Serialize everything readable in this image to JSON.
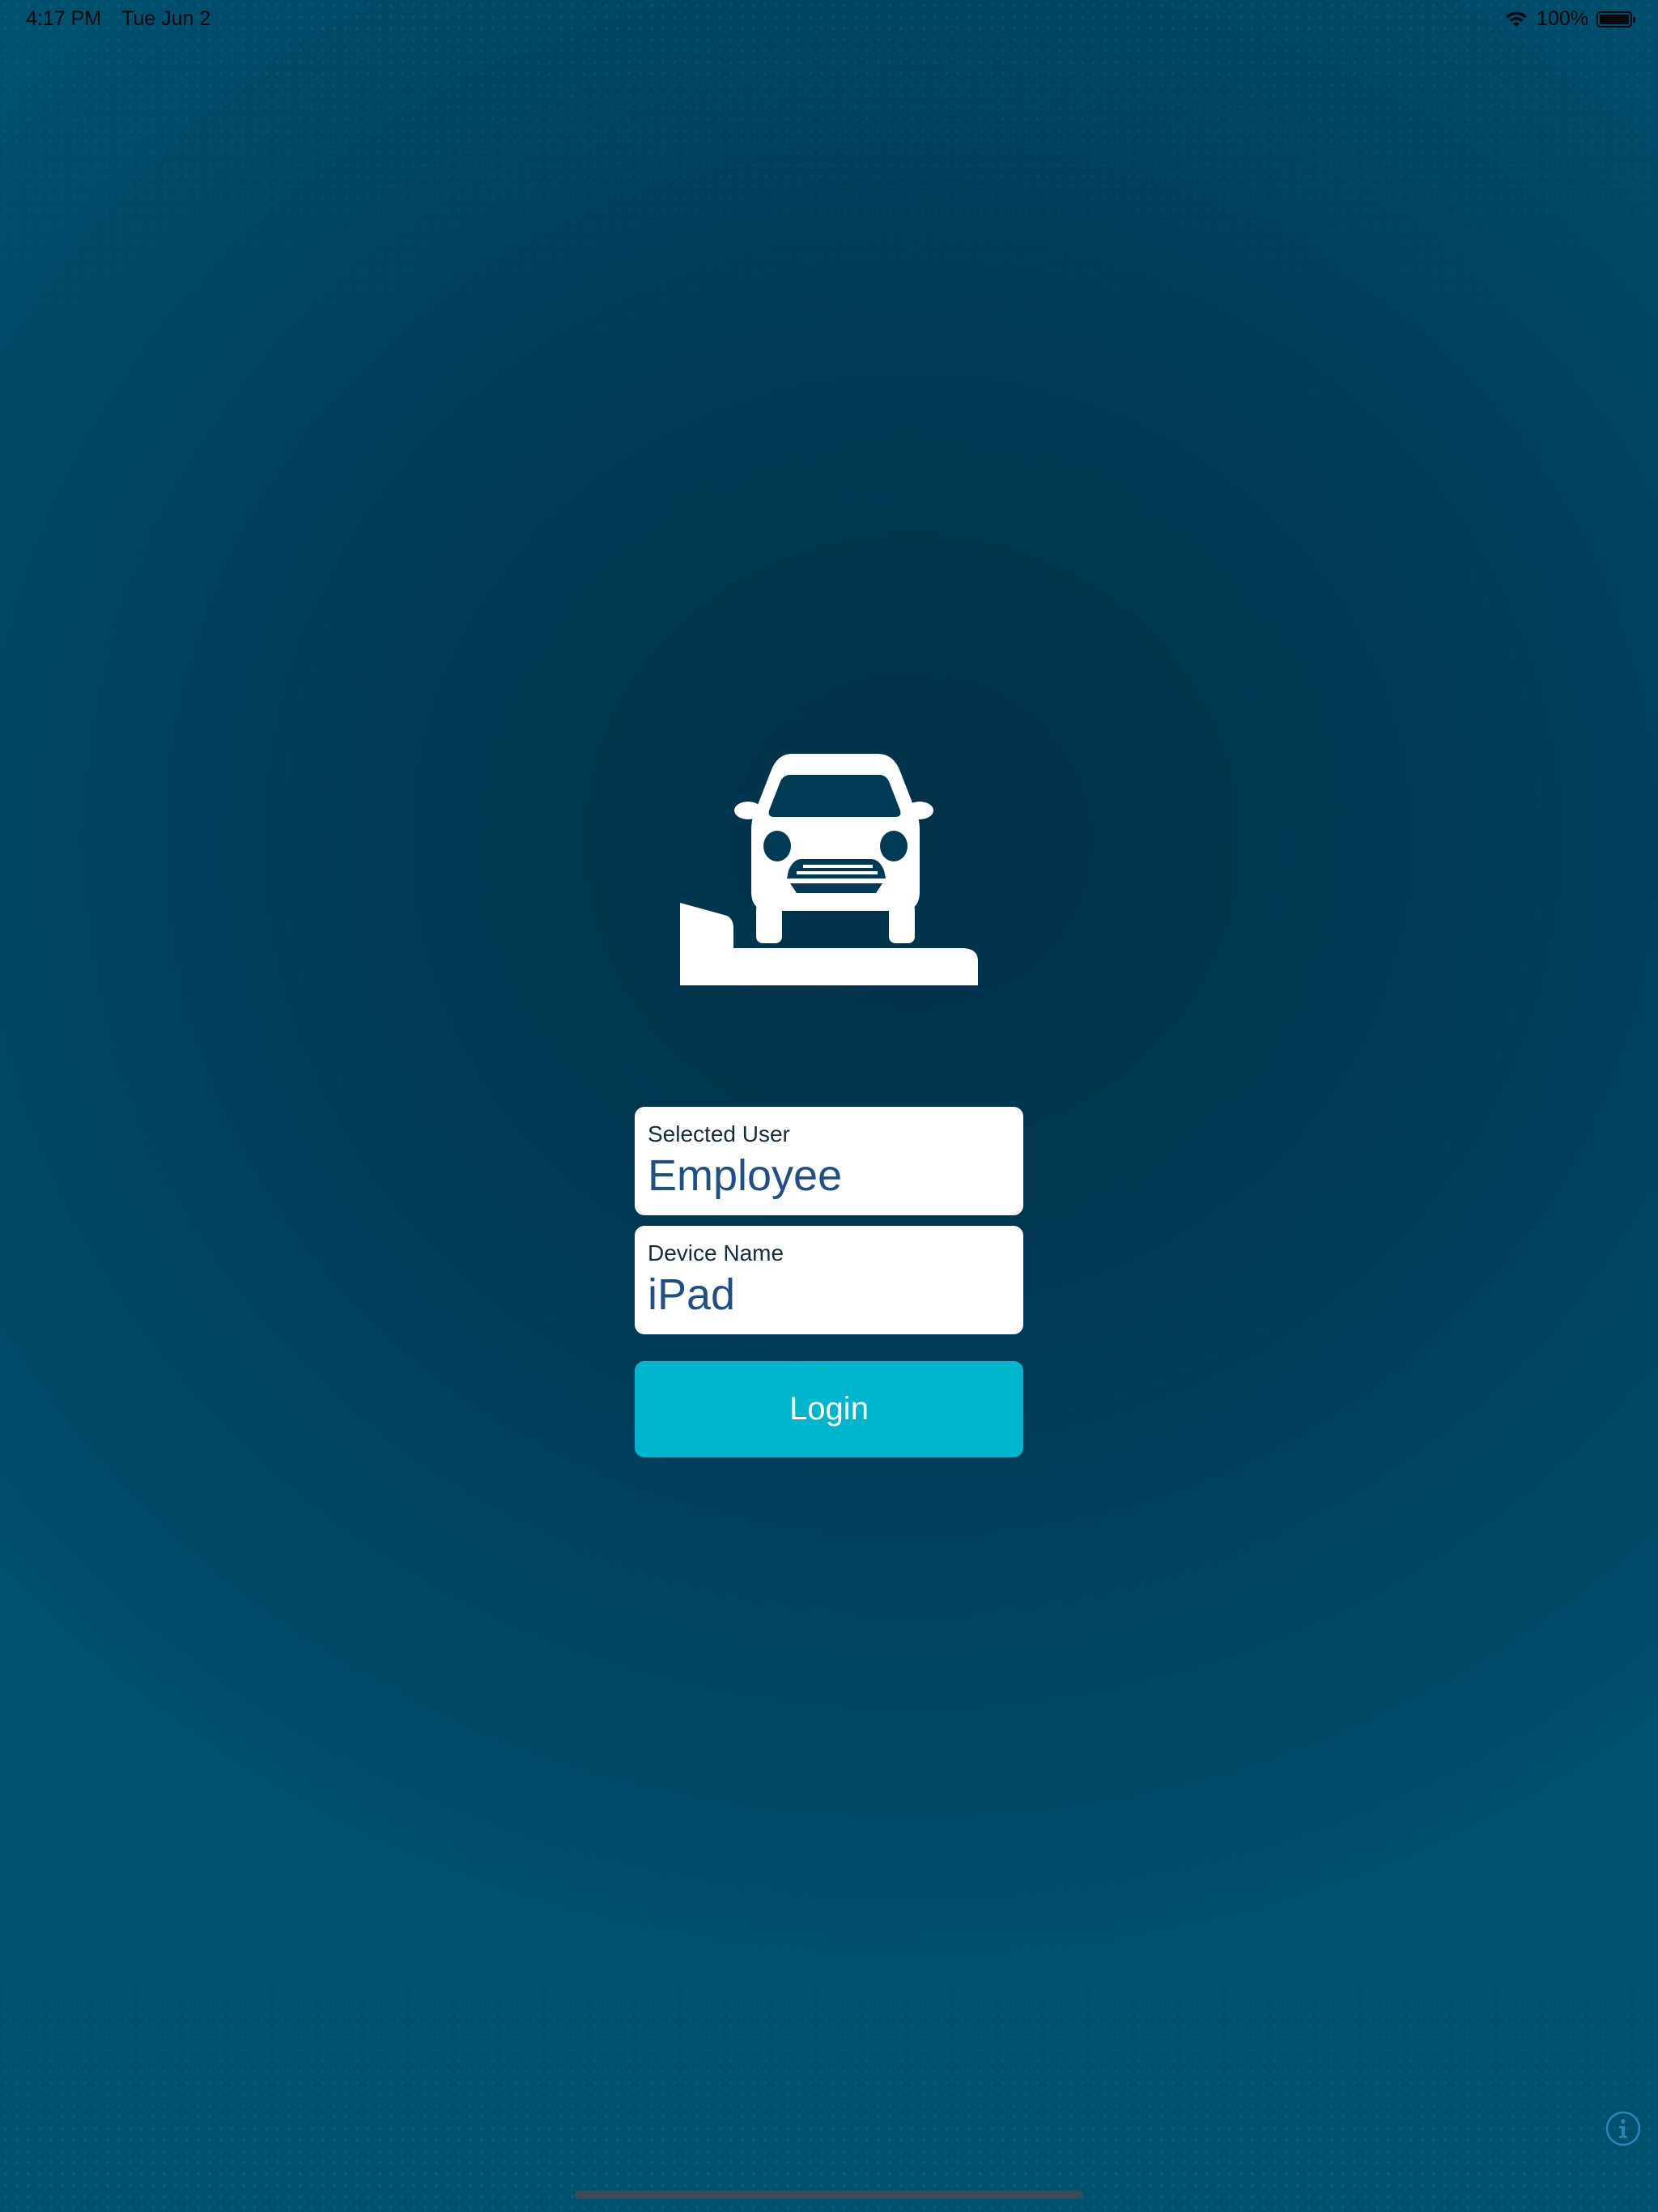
{
  "status_bar": {
    "time": "4:17 PM",
    "date": "Tue Jun 2",
    "battery_percent": "100%",
    "icons": [
      "wifi-icon",
      "battery-icon"
    ]
  },
  "logo": {
    "icon": "car-on-ramp-icon"
  },
  "form": {
    "user_label": "Selected User",
    "user_value": "Employee",
    "device_label": "Device Name",
    "device_value": "iPad",
    "login_label": "Login"
  },
  "footer": {
    "info_icon": "info-icon"
  },
  "colors": {
    "background": "#003a55",
    "field_bg": "#ffffff",
    "field_value": "#1f4f86",
    "button": "#00b6cf",
    "button_text": "#ffffff"
  }
}
